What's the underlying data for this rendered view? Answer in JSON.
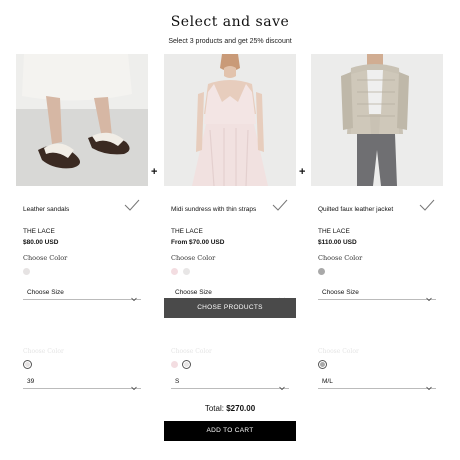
{
  "header": {
    "title": "Select and save",
    "subtitle": "Select 3 products and get 25% discount"
  },
  "products": [
    {
      "name": "Leather sandals",
      "brand": "THE LACE",
      "price": "$80.00 USD",
      "choose_color": "Choose Color",
      "swatch_colors": [
        "#e6e3e3"
      ],
      "size_placeholder": "Choose Size",
      "selected_size": "39",
      "selected_swatch_color": "#e6e3e3"
    },
    {
      "name": "Midi sundress with thin straps",
      "brand": "THE LACE",
      "price": "From $70.00 USD",
      "choose_color": "Choose Color",
      "swatch_colors": [
        "#f3dde1",
        "#e8e6e6"
      ],
      "size_placeholder": "Choose Size",
      "selected_size": "S",
      "selected_swatch_color": "#e8e6e6",
      "unselected_swatch_color": "#f3dde1"
    },
    {
      "name": "Quilted faux leather jacket",
      "brand": "THE LACE",
      "price": "$110.00 USD",
      "choose_color": "Choose Color",
      "swatch_colors": [
        "#a9a9a9"
      ],
      "size_placeholder": "Choose Size",
      "selected_size": "M/L",
      "selected_swatch_color": "#a9a9a9"
    }
  ],
  "plus_sign": "+",
  "chose_products_label": "CHOSE PRODUCTS",
  "total": {
    "label": "Total:",
    "value": "$270.00"
  },
  "add_to_cart_label": "ADD TO CART",
  "colors": {
    "dark_button": "#4a4a4a",
    "cart_button": "#000000"
  }
}
